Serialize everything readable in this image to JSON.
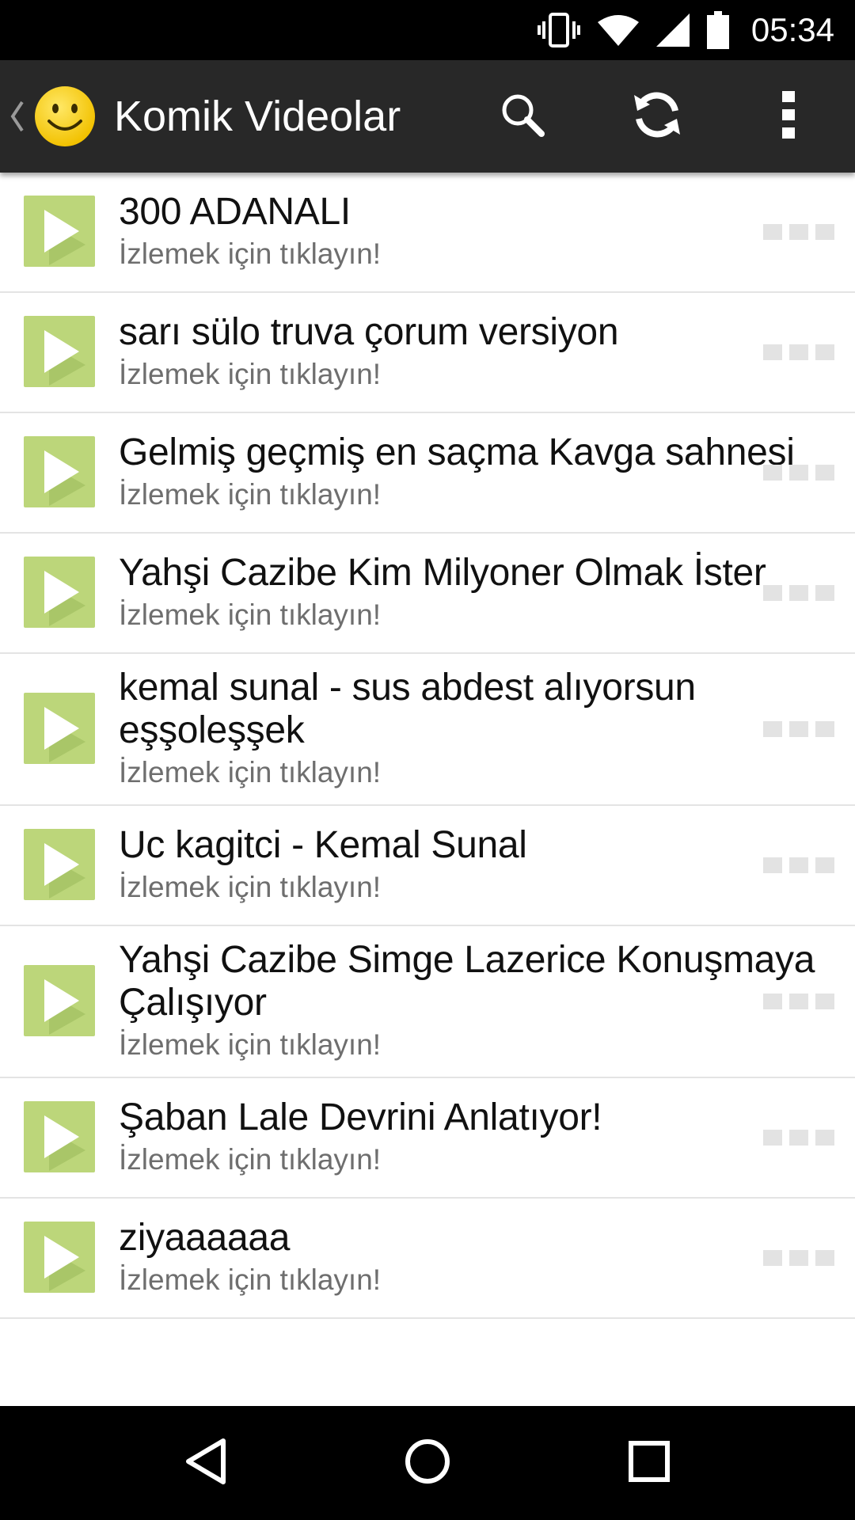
{
  "status_bar": {
    "time": "05:34",
    "icons": [
      "vibrate-icon",
      "wifi-icon",
      "cell-signal-icon",
      "battery-icon"
    ]
  },
  "action_bar": {
    "title": "Komik Videolar",
    "actions": [
      "search-icon",
      "refresh-icon",
      "overflow-menu-icon"
    ]
  },
  "colors": {
    "action_bar_bg": "#282828",
    "thumb_green": "#bcd67a",
    "thumb_shade": "#a6c466",
    "subtitle_gray": "#6e6e6e",
    "divider": "#e4e4e4"
  },
  "videos": [
    {
      "title": "300 ADANALI",
      "subtitle": "İzlemek için tıklayın!"
    },
    {
      "title": "sarı sülo truva çorum versiyon",
      "subtitle": "İzlemek için tıklayın!"
    },
    {
      "title": "Gelmiş geçmiş en saçma Kavga sahnesi",
      "subtitle": "İzlemek için tıklayın!"
    },
    {
      "title": "Yahşi Cazibe Kim Milyoner Olmak İster",
      "subtitle": "İzlemek için tıklayın!"
    },
    {
      "title": "kemal sunal - sus abdest alıyorsun eşşoleşşek",
      "subtitle": "İzlemek için tıklayın!"
    },
    {
      "title": "Uc kagitci - Kemal Sunal",
      "subtitle": "İzlemek için tıklayın!"
    },
    {
      "title": "Yahşi Cazibe Simge Lazerice Konuşmaya Çalışıyor",
      "subtitle": "İzlemek için tıklayın!"
    },
    {
      "title": "Şaban Lale Devrini Anlatıyor!",
      "subtitle": "İzlemek için tıklayın!"
    },
    {
      "title": "ziyaaaaaa",
      "subtitle": "İzlemek için tıklayın!"
    }
  ],
  "nav_bar": [
    "back-icon",
    "home-icon",
    "recents-icon"
  ]
}
